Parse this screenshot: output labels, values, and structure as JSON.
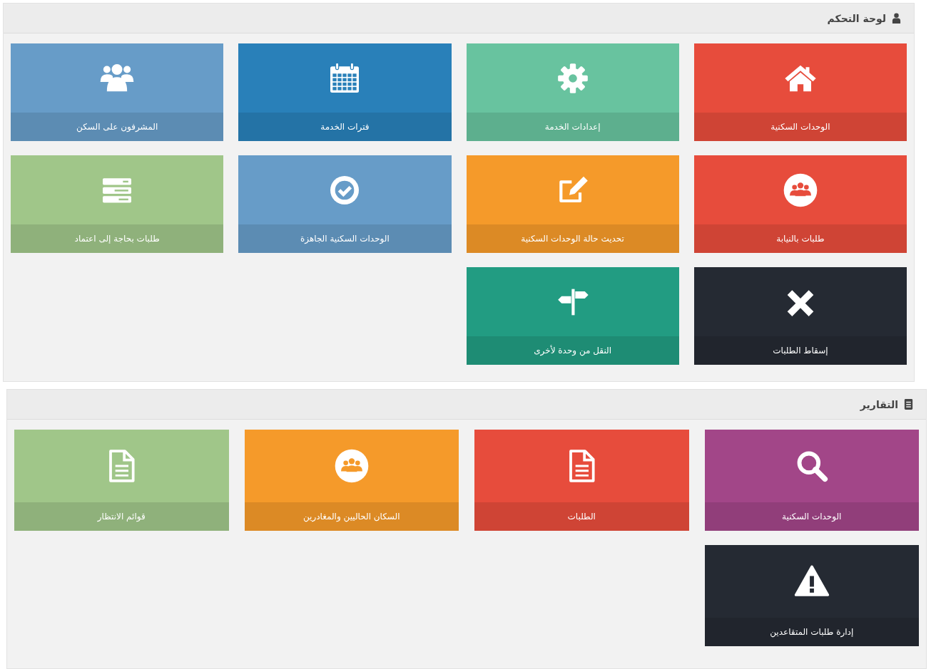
{
  "panels": [
    {
      "title": "لوحة التحكم",
      "tiles": [
        {
          "label": "الوحدات السكنية",
          "kind": "home",
          "color": "#e74c3c"
        },
        {
          "label": "إعدادات الخدمة",
          "kind": "gear",
          "color": "#68c39f"
        },
        {
          "label": "فترات الخدمة",
          "kind": "calendar",
          "color": "#2980b9"
        },
        {
          "label": "المشرفون على السكن",
          "kind": "users",
          "color": "#679cc8"
        },
        {
          "label": "طلبات بالنيابة",
          "kind": "group",
          "color": "#e74c3c"
        },
        {
          "label": "تحديث حالة الوحدات السكنية",
          "kind": "edit",
          "color": "#f59a2a"
        },
        {
          "label": "الوحدات السكنية الجاهزة",
          "kind": "check",
          "color": "#679cc8"
        },
        {
          "label": "طلبات بحاجة إلى اعتماد",
          "kind": "server",
          "color": "#a0c689"
        },
        {
          "label": "إسقاط الطلبات",
          "kind": "close",
          "color": "#252a33"
        },
        {
          "label": "النقل من وحدة لأخرى",
          "kind": "signpost",
          "color": "#229c82"
        }
      ]
    },
    {
      "title": "التقارير",
      "tiles": [
        {
          "label": "الوحدات السكنية",
          "kind": "search",
          "color": "#a24688"
        },
        {
          "label": "الطلبات",
          "kind": "document",
          "color": "#e74c3c"
        },
        {
          "label": "السكان الحاليين والمغادرين",
          "kind": "group",
          "color": "#f59a2a"
        },
        {
          "label": "قوائم الانتظار",
          "kind": "document",
          "color": "#a0c689"
        },
        {
          "label": "إدارة طلبات المتقاعدين",
          "kind": "warning",
          "color": "#252a33"
        }
      ]
    }
  ]
}
